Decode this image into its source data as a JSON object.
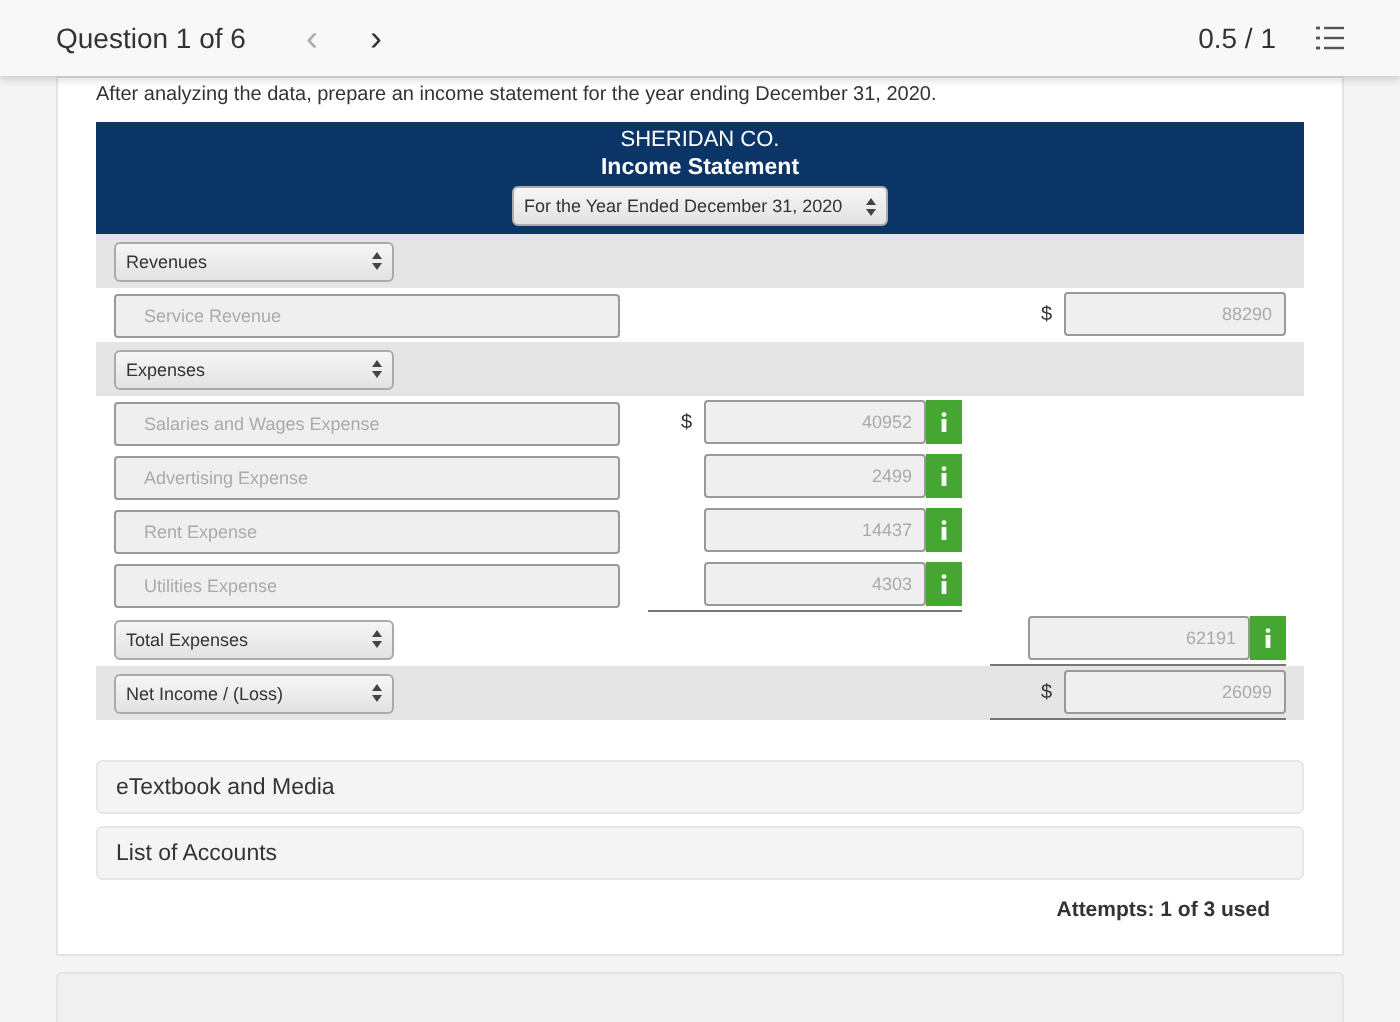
{
  "header": {
    "question": "Question 1 of 6",
    "prev": "‹",
    "next": "›",
    "score": "0.5 / 1"
  },
  "instruction": "After analyzing the data, prepare an income statement for the year ending December 31, 2020.",
  "statement": {
    "company": "SHERIDAN CO.",
    "title": "Income Statement",
    "period": "For the Year Ended December 31, 2020",
    "rows": [
      {
        "kind": "select",
        "label": "Revenues",
        "shaded": true
      },
      {
        "kind": "account",
        "name": "Service Revenue",
        "shaded": false,
        "second": {
          "dollar": "$",
          "amount": "88290",
          "info": false,
          "rule_below": false
        }
      },
      {
        "kind": "select",
        "label": "Expenses",
        "shaded": true
      },
      {
        "kind": "account",
        "name": "Salaries and Wages Expense",
        "shaded": false,
        "first": {
          "dollar": "$",
          "amount": "40952",
          "info": true,
          "rule_below": false
        }
      },
      {
        "kind": "account",
        "name": "Advertising Expense",
        "shaded": false,
        "first": {
          "amount": "2499",
          "info": true,
          "rule_below": false
        }
      },
      {
        "kind": "account",
        "name": "Rent Expense",
        "shaded": false,
        "first": {
          "amount": "14437",
          "info": true,
          "rule_below": false
        }
      },
      {
        "kind": "account",
        "name": "Utilities Expense",
        "shaded": false,
        "first": {
          "amount": "4303",
          "info": true,
          "rule_below": true
        }
      },
      {
        "kind": "select",
        "label": "Total Expenses",
        "shaded": false,
        "second": {
          "amount": "62191",
          "info": true,
          "rule_below": true
        }
      },
      {
        "kind": "select",
        "label": "Net Income / (Loss)",
        "shaded": true,
        "second": {
          "dollar": "$",
          "amount": "26099",
          "info": false,
          "rule_below": true
        }
      }
    ]
  },
  "links": [
    "eTextbook and Media",
    "List of Accounts"
  ],
  "attempts": "Attempts: 1 of 3 used"
}
